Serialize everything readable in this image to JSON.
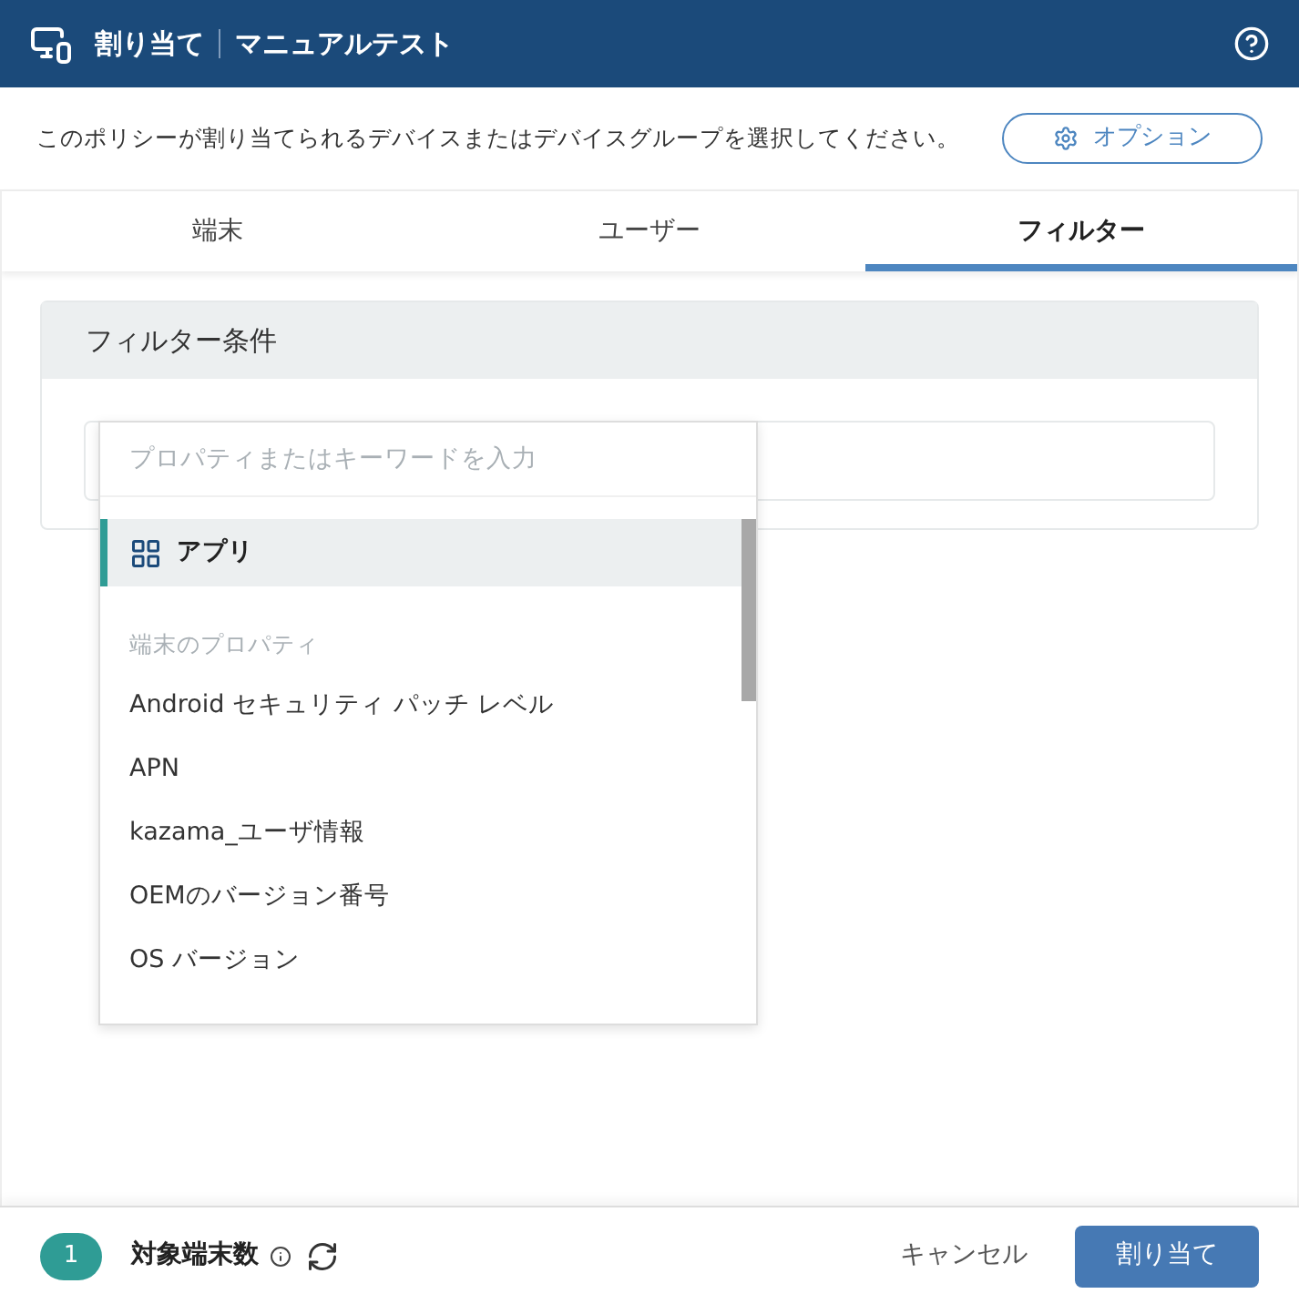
{
  "header": {
    "title": "割り当て",
    "subtitle": "マニュアルテスト"
  },
  "description": "このポリシーが割り当てられるデバイスまたはデバイスグループを選択してください。",
  "options_button": "オプション",
  "tabs": [
    {
      "label": "端末",
      "selected": false
    },
    {
      "label": "ユーザー",
      "selected": false
    },
    {
      "label": "フィルター",
      "selected": true
    }
  ],
  "filter_panel": {
    "title": "フィルター条件"
  },
  "dropdown": {
    "placeholder": "プロパティまたはキーワードを入力",
    "items": [
      {
        "kind": "option",
        "label": "アプリ",
        "selected": true,
        "icon": true
      },
      {
        "kind": "header",
        "label": "端末のプロパティ"
      },
      {
        "kind": "option",
        "label": "Android セキュリティ パッチ レベル",
        "selected": false
      },
      {
        "kind": "option",
        "label": "APN",
        "selected": false
      },
      {
        "kind": "option",
        "label": "kazama_ユーザ情報",
        "selected": false
      },
      {
        "kind": "option",
        "label": "OEMのバージョン番号",
        "selected": false
      },
      {
        "kind": "option",
        "label": "OS バージョン",
        "selected": false
      }
    ]
  },
  "footer": {
    "count": "1",
    "count_label": "対象端末数",
    "cancel": "キャンセル",
    "assign": "割り当て"
  }
}
